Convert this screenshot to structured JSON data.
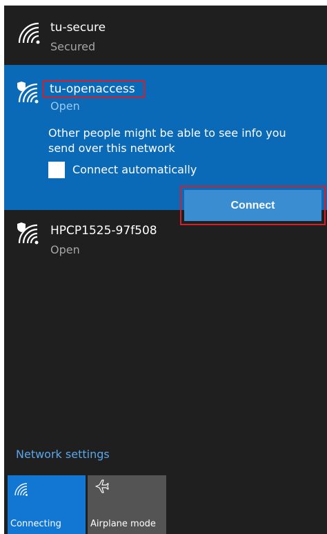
{
  "networks": [
    {
      "name": "tu-secure",
      "status": "Secured",
      "icon": "wifi-icon",
      "secured": true
    },
    {
      "name": "tu-openaccess",
      "status": "Open",
      "icon": "wifi-shield-icon",
      "secured": false,
      "selected": true
    },
    {
      "name": "HPCP1525-97f508",
      "status": "Open",
      "icon": "wifi-shield-icon",
      "secured": false
    }
  ],
  "selected_network": {
    "warning": "Other people might be able to see info you send over this network",
    "connect_automatically_label": "Connect automatically",
    "connect_automatically_checked": false,
    "connect_button_label": "Connect"
  },
  "network_settings_label": "Network settings",
  "quick_actions": [
    {
      "label": "Connecting",
      "icon": "wifi-icon",
      "active": true
    },
    {
      "label": "Airplane mode",
      "icon": "airplane-icon",
      "active": false
    }
  ],
  "colors": {
    "panel_bg": "#1f1f1f",
    "selected_bg": "#0a6ab8",
    "connect_button": "#3a8dd0",
    "highlight_box": "#d32029",
    "link": "#5aa7ec",
    "tile_active": "#1276d3",
    "tile_inactive": "#545454"
  }
}
